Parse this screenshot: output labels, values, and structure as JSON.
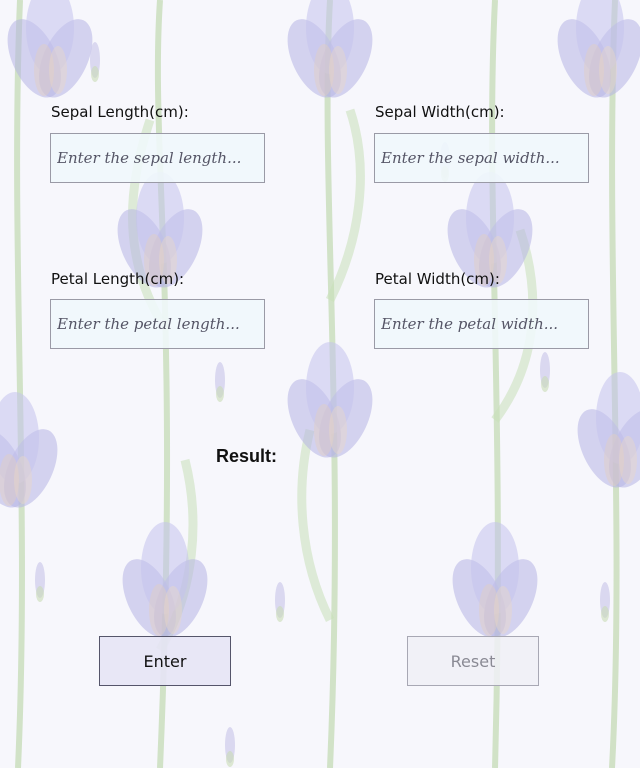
{
  "form": {
    "sepal_length": {
      "label": "Sepal Length(cm):",
      "placeholder": "Enter the sepal length...",
      "value": ""
    },
    "sepal_width": {
      "label": "Sepal Width(cm):",
      "placeholder": "Enter the sepal width...",
      "value": ""
    },
    "petal_length": {
      "label": "Petal Length(cm):",
      "placeholder": "Enter the petal length...",
      "value": ""
    },
    "petal_width": {
      "label": "Petal Width(cm):",
      "placeholder": "Enter the petal width...",
      "value": ""
    }
  },
  "result": {
    "label": "Result:",
    "value": ""
  },
  "buttons": {
    "enter_label": "Enter",
    "reset_label": "Reset",
    "reset_enabled": false
  },
  "colors": {
    "background": "#f7f7fc",
    "iris_petal": "#b6b4e4",
    "stem": "#b9d4a8"
  }
}
